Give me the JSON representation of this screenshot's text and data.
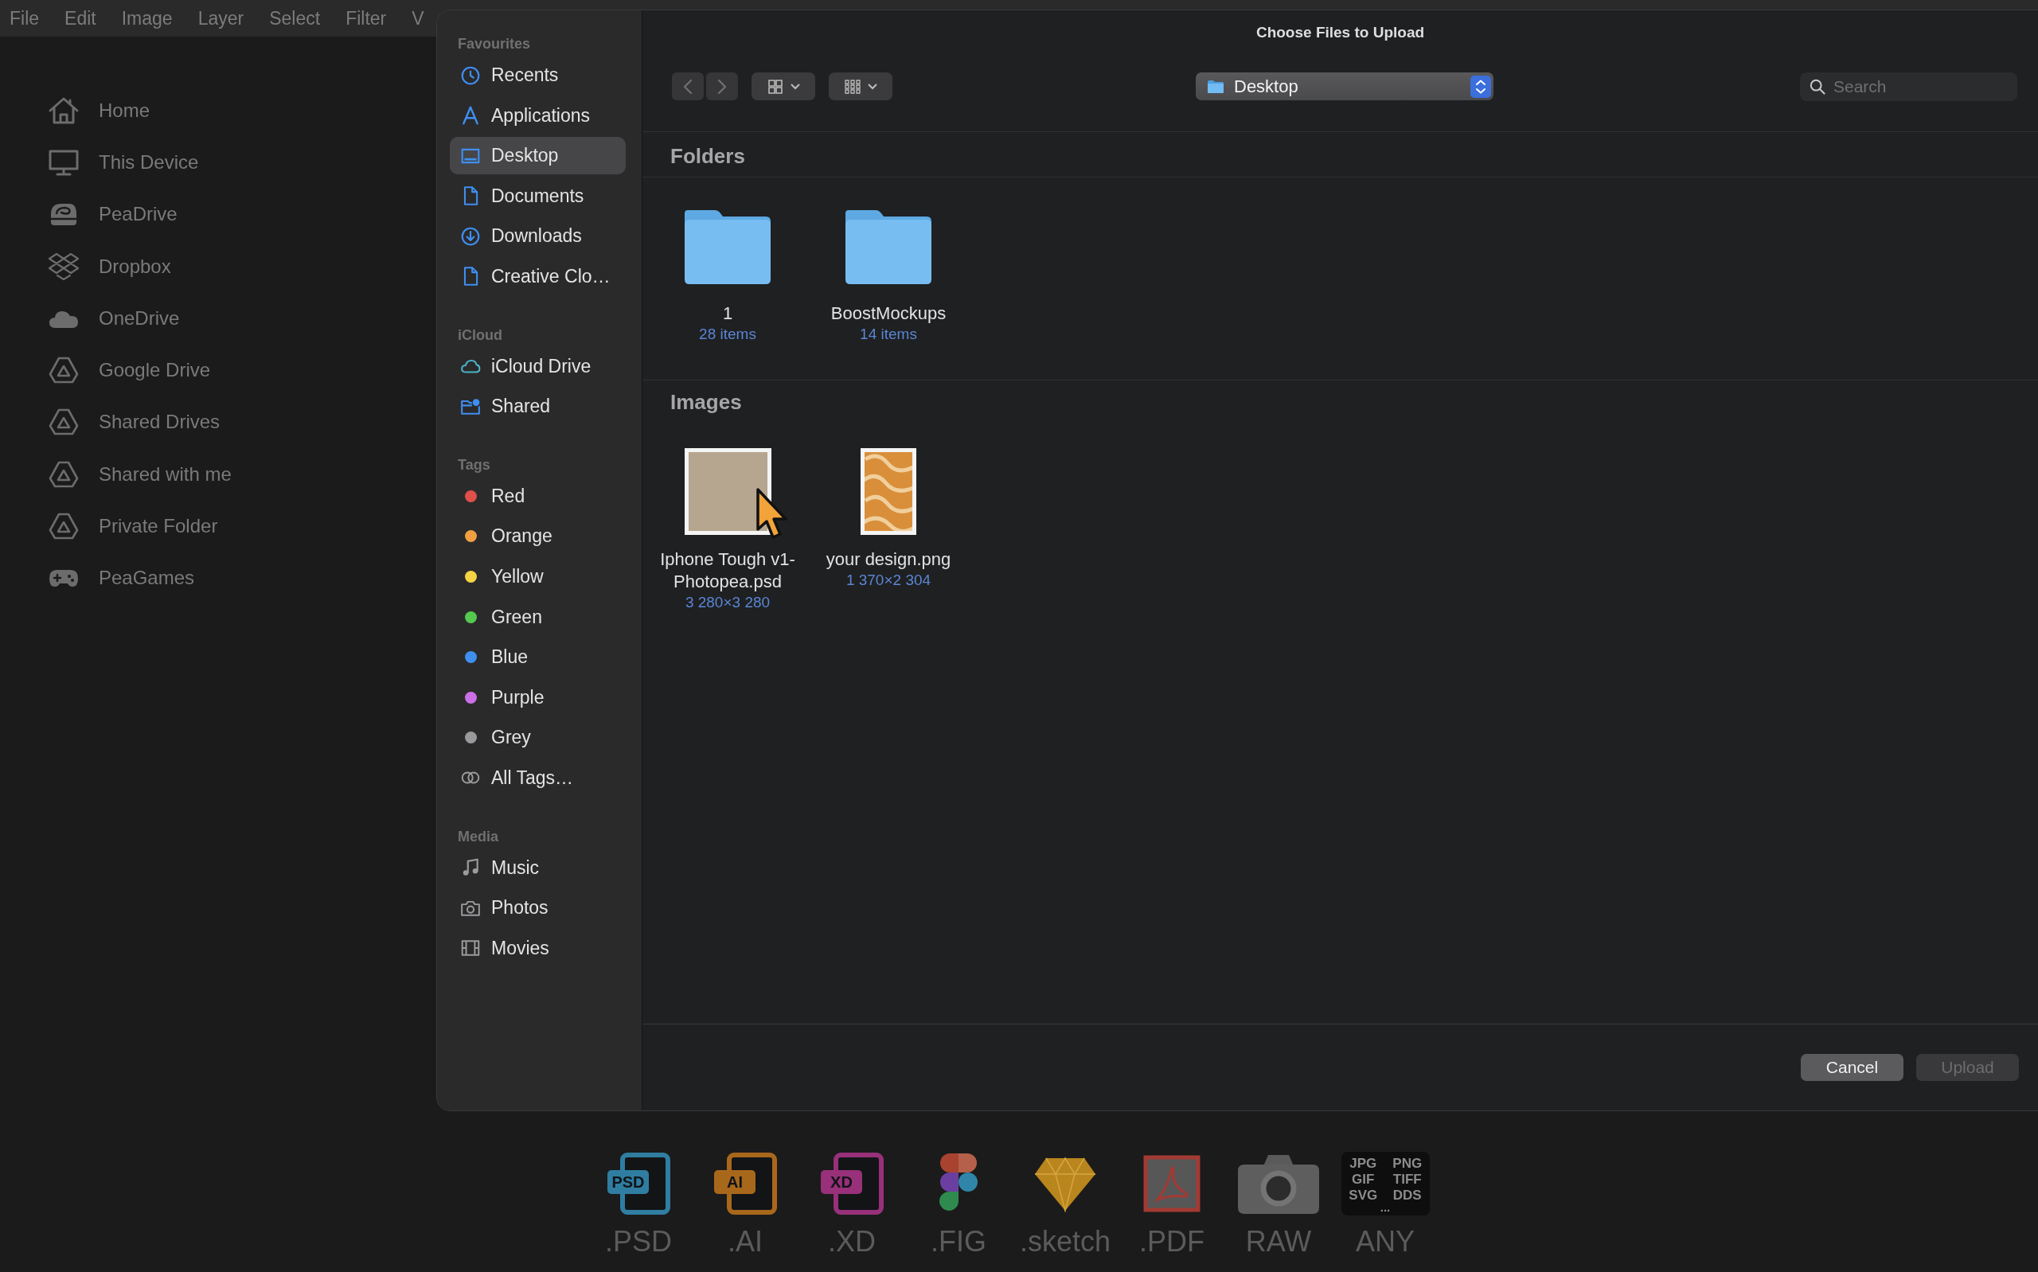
{
  "menu_bar": {
    "items": [
      "File",
      "Edit",
      "Image",
      "Layer",
      "Select",
      "Filter",
      "V"
    ]
  },
  "storage_list": {
    "items": [
      "Home",
      "This Device",
      "PeaDrive",
      "Dropbox",
      "OneDrive",
      "Google Drive",
      "Shared Drives",
      "Shared with me",
      "Private Folder",
      "PeaGames"
    ]
  },
  "dialog": {
    "title": "Choose Files to Upload",
    "sidebar": {
      "sections": [
        {
          "heading": "Favourites",
          "items": [
            {
              "label": "Recents",
              "selected": false
            },
            {
              "label": "Applications",
              "selected": false
            },
            {
              "label": "Desktop",
              "selected": true
            },
            {
              "label": "Documents",
              "selected": false
            },
            {
              "label": "Downloads",
              "selected": false
            },
            {
              "label": "Creative Clo…",
              "selected": false
            }
          ]
        },
        {
          "heading": "iCloud",
          "items": [
            {
              "label": "iCloud Drive",
              "selected": false
            },
            {
              "label": "Shared",
              "selected": false
            }
          ]
        },
        {
          "heading": "Tags",
          "items": [
            {
              "label": "Red",
              "selected": false,
              "color": "#e0504a"
            },
            {
              "label": "Orange",
              "selected": false,
              "color": "#f0a040"
            },
            {
              "label": "Yellow",
              "selected": false,
              "color": "#f4d444"
            },
            {
              "label": "Green",
              "selected": false,
              "color": "#55c84f"
            },
            {
              "label": "Blue",
              "selected": false,
              "color": "#3f8fef"
            },
            {
              "label": "Purple",
              "selected": false,
              "color": "#cc6fe6"
            },
            {
              "label": "Grey",
              "selected": false,
              "color": "#99999b"
            },
            {
              "label": "All Tags…",
              "selected": false
            }
          ]
        },
        {
          "heading": "Media",
          "items": [
            {
              "label": "Music",
              "selected": false
            },
            {
              "label": "Photos",
              "selected": false
            },
            {
              "label": "Movies",
              "selected": false
            }
          ]
        }
      ]
    },
    "toolbar": {
      "location": "Desktop",
      "search": {
        "placeholder": "Search"
      }
    },
    "groups": [
      {
        "heading": "Folders",
        "kind": "folders",
        "items": [
          {
            "name": "1",
            "detail": "28 items"
          },
          {
            "name": "BoostMockups",
            "detail": "14 items"
          }
        ]
      },
      {
        "heading": "Images",
        "kind": "images",
        "items": [
          {
            "name": "Iphone Tough v1-Photopea.psd",
            "detail": "3 280×3 280"
          },
          {
            "name": "your design.png",
            "detail": "1 370×2 304"
          }
        ]
      }
    ],
    "buttons": [
      {
        "label": "Cancel",
        "disabled": false
      },
      {
        "label": "Upload",
        "disabled": true
      }
    ]
  },
  "formats": [
    {
      "badge": "PSD",
      "label": ".PSD"
    },
    {
      "badge": "AI",
      "label": ".AI"
    },
    {
      "badge": "XD",
      "label": ".XD"
    },
    {
      "label": ".FIG"
    },
    {
      "label": ".sketch"
    },
    {
      "label": ".PDF"
    },
    {
      "label": "RAW"
    },
    {
      "tile_texts": [
        "JPG",
        "PNG",
        "GIF",
        "TIFF",
        "SVG",
        "DDS",
        "..."
      ],
      "label": "ANY"
    }
  ]
}
